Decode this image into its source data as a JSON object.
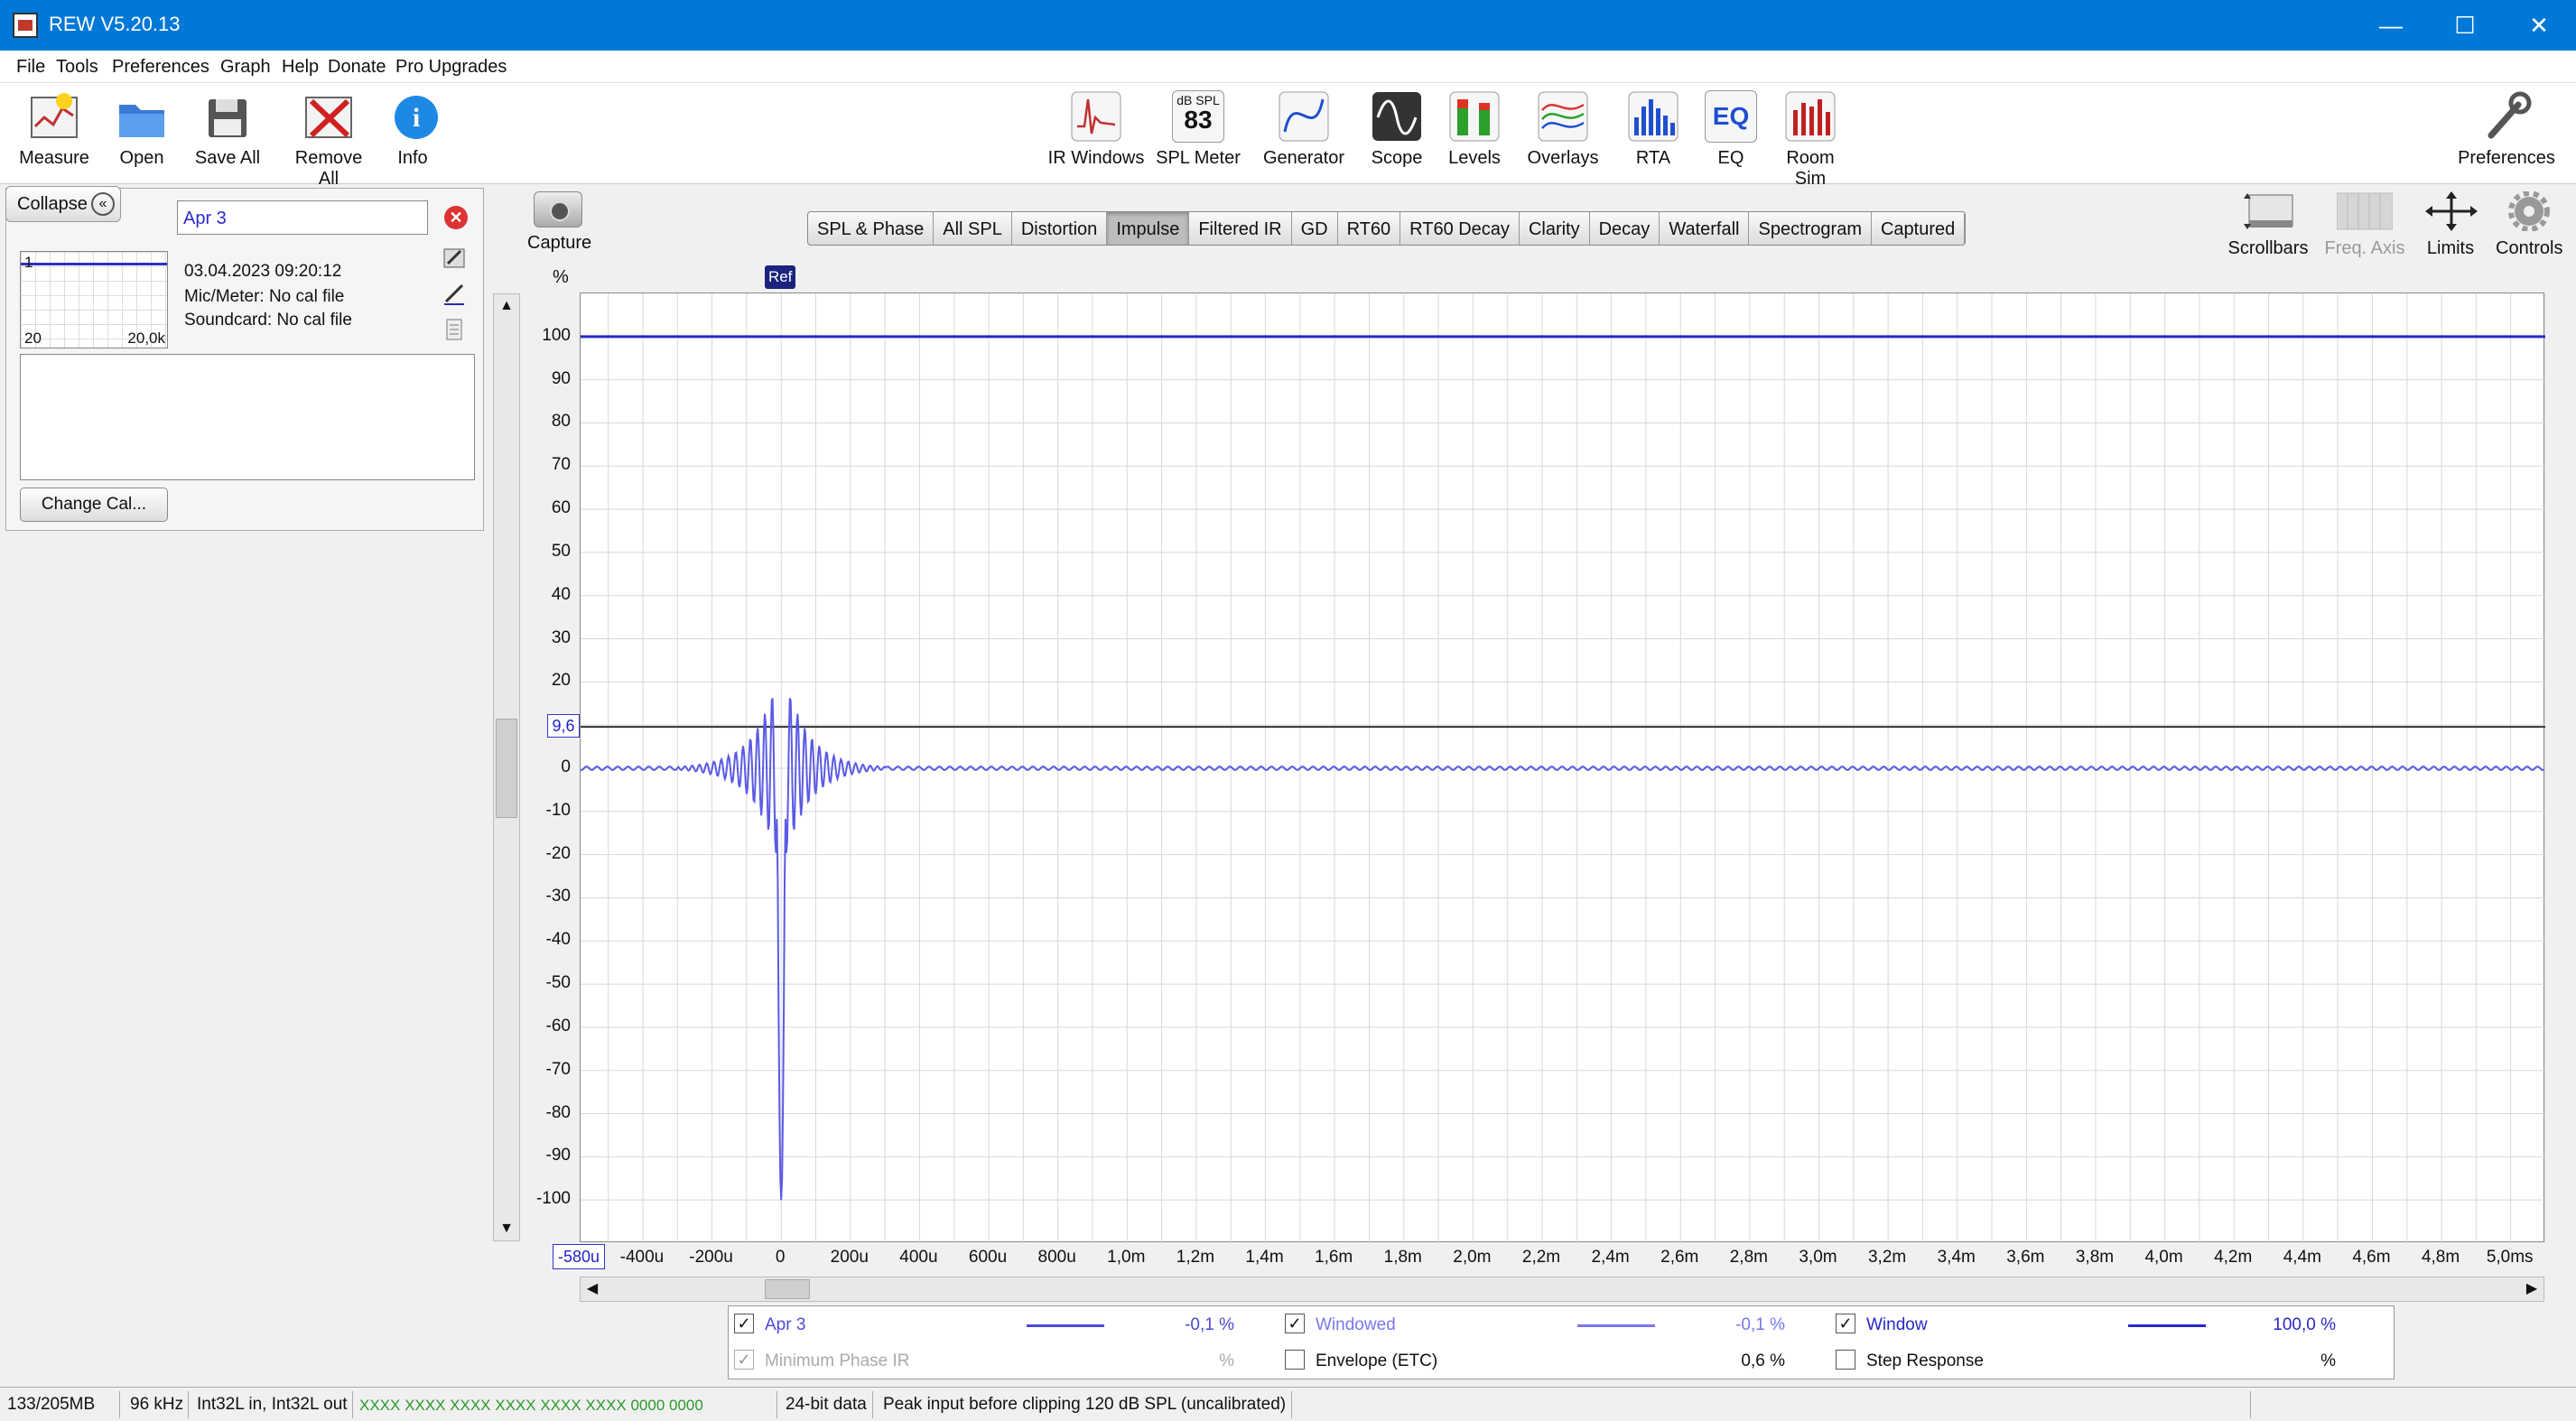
{
  "window": {
    "title": "REW V5.20.13",
    "minimize": "—",
    "maximize": "☐",
    "close": "✕"
  },
  "menu": [
    "File",
    "Tools",
    "Preferences",
    "Graph",
    "Help",
    "Donate",
    "Pro Upgrades"
  ],
  "toolbar_left": [
    {
      "label": "Measure",
      "icon": "measure-icon"
    },
    {
      "label": "Open",
      "icon": "folder-icon"
    },
    {
      "label": "Save All",
      "icon": "save-icon"
    },
    {
      "label": "Remove All",
      "icon": "remove-icon"
    },
    {
      "label": "Info",
      "icon": "info-icon"
    }
  ],
  "toolbar_center": [
    {
      "label": "IR Windows",
      "icon": "ir-windows-icon"
    },
    {
      "label": "SPL Meter",
      "icon": "spl-meter-icon",
      "badge_top": "dB SPL",
      "badge_value": "83"
    },
    {
      "label": "Generator",
      "icon": "generator-icon"
    },
    {
      "label": "Scope",
      "icon": "scope-icon"
    },
    {
      "label": "Levels",
      "icon": "levels-icon"
    },
    {
      "label": "Overlays",
      "icon": "overlays-icon"
    },
    {
      "label": "RTA",
      "icon": "rta-icon"
    },
    {
      "label": "EQ",
      "icon": "eq-icon",
      "badge_value": "EQ"
    },
    {
      "label": "Room Sim",
      "icon": "room-sim-icon"
    }
  ],
  "toolbar_right": {
    "label": "Preferences",
    "icon": "wrench-icon"
  },
  "left_panel": {
    "collapse_label": "Collapse",
    "measurement_name": "Apr 3",
    "thumb_index": "1",
    "thumb_x_start": "20",
    "thumb_x_end": "20,0k",
    "date": "03.04.2023 09:20:12",
    "mic": "Mic/Meter: No cal file",
    "soundcard": "Soundcard: No cal file",
    "change_cal": "Change Cal..."
  },
  "capture": {
    "label": "Capture"
  },
  "graph_tabs": [
    "SPL & Phase",
    "All SPL",
    "Distortion",
    "Impulse",
    "Filtered IR",
    "GD",
    "RT60",
    "RT60 Decay",
    "Clarity",
    "Decay",
    "Waterfall",
    "Spectrogram",
    "Captured"
  ],
  "active_tab": "Impulse",
  "graph_controls": [
    {
      "label": "Scrollbars",
      "icon": "scrollbars-icon",
      "enabled": true
    },
    {
      "label": "Freq. Axis",
      "icon": "freq-axis-icon",
      "enabled": false
    },
    {
      "label": "Limits",
      "icon": "limits-icon",
      "enabled": true
    },
    {
      "label": "Controls",
      "icon": "gear-icon",
      "enabled": true
    }
  ],
  "colors": {
    "trace": "#5a5ae6",
    "ref_line": "#2828c8",
    "cursor_line": "#333333",
    "accent": "#0078d7"
  },
  "chart_data": {
    "type": "line",
    "ylabel": "%",
    "ylim": [
      -110,
      110
    ],
    "xlim": [
      -0.58,
      5.1
    ],
    "x_unit_ms": true,
    "y_ticks": [
      "100",
      "90",
      "80",
      "70",
      "60",
      "50",
      "40",
      "30",
      "20",
      "10",
      "0",
      "-10",
      "-20",
      "-30",
      "-40",
      "-50",
      "-60",
      "-70",
      "-80",
      "-90",
      "-100"
    ],
    "y_tick_values": [
      100,
      90,
      80,
      70,
      60,
      50,
      40,
      30,
      20,
      10,
      0,
      -10,
      -20,
      -30,
      -40,
      -50,
      -60,
      -70,
      -80,
      -90,
      -100
    ],
    "x_ticks": [
      "-400u",
      "-200u",
      "0",
      "200u",
      "400u",
      "600u",
      "800u",
      "1,0m",
      "1,2m",
      "1,4m",
      "1,6m",
      "1,8m",
      "2,0m",
      "2,2m",
      "2,4m",
      "2,6m",
      "2,8m",
      "3,0m",
      "3,2m",
      "3,4m",
      "3,6m",
      "3,8m",
      "4,0m",
      "4,2m",
      "4,4m",
      "4,6m",
      "4,8m",
      "5,0ms"
    ],
    "x_tick_values": [
      -0.4,
      -0.2,
      0,
      0.2,
      0.4,
      0.6,
      0.8,
      1.0,
      1.2,
      1.4,
      1.6,
      1.8,
      2.0,
      2.2,
      2.4,
      2.6,
      2.8,
      3.0,
      3.2,
      3.4,
      3.6,
      3.8,
      4.0,
      4.2,
      4.4,
      4.6,
      4.8,
      5.0
    ],
    "x_start_label": "-580u",
    "window_level": 100,
    "cursor_value": 9.6,
    "cursor_label": "9,6",
    "ref_marker": {
      "label": "Ref",
      "x": 0
    },
    "impulse": {
      "peak_negative": -100,
      "peak_positive": 21,
      "ringing_end_x": 0.3
    }
  },
  "legend": {
    "row1": [
      {
        "label": "Apr 3",
        "checked": true,
        "value": "-0,1 %",
        "color": "#5a5ae6"
      },
      {
        "label": "Windowed",
        "checked": true,
        "value": "-0,1 %",
        "color": "#7777ee"
      },
      {
        "label": "Window",
        "checked": true,
        "value": "100,0 %",
        "color": "#2828c8"
      }
    ],
    "row2": [
      {
        "label": "Minimum Phase IR",
        "checked": true,
        "disabled": true,
        "value": "%"
      },
      {
        "label": "Envelope (ETC)",
        "checked": false,
        "value": "0,6 %"
      },
      {
        "label": "Step Response",
        "checked": false,
        "value": "%"
      }
    ]
  },
  "status": {
    "memory": "133/205MB",
    "rate": "96 kHz",
    "io": "Int32L in, Int32L out",
    "levels": "XXXX XXXX  XXXX XXXX  XXXX XXXX  0000 0000",
    "bits": "24-bit data",
    "peak": "Peak input before clipping 120 dB SPL (uncalibrated)"
  }
}
